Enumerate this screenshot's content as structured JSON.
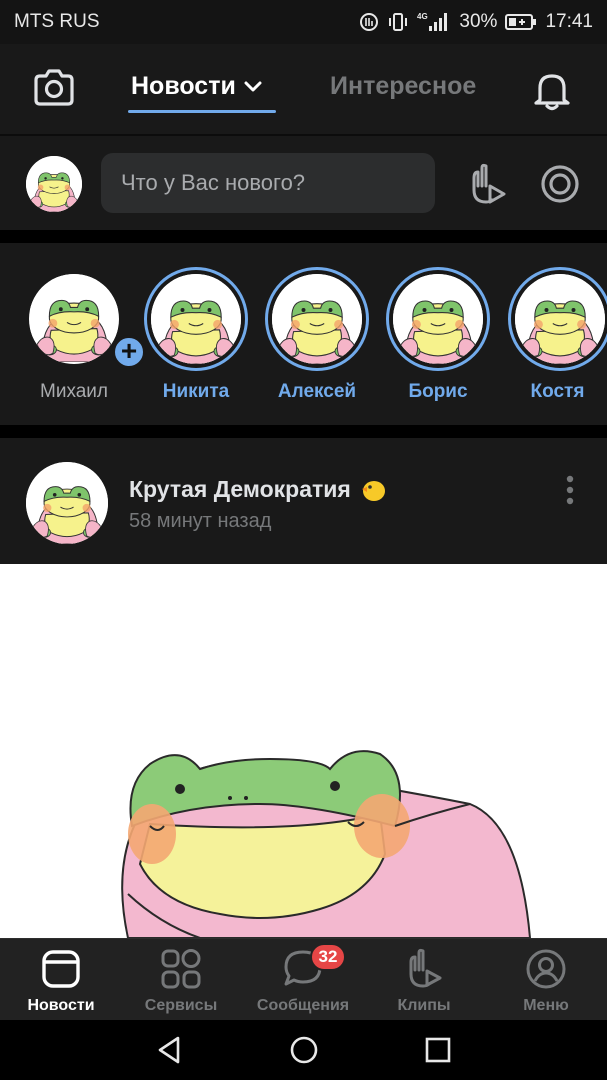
{
  "status_bar": {
    "carrier": "MTS RUS",
    "network": "4G",
    "battery": "30%",
    "time": "17:41"
  },
  "header": {
    "tab_news": "Новости",
    "tab_interesting": "Интересное",
    "camera_icon": "camera-icon",
    "bell_icon": "bell-icon"
  },
  "compose": {
    "placeholder": "Что у Вас нового?"
  },
  "stories": [
    {
      "name": "Михаил",
      "own": true
    },
    {
      "name": "Никита",
      "own": false
    },
    {
      "name": "Алексей",
      "own": false
    },
    {
      "name": "Борис",
      "own": false
    },
    {
      "name": "Костя",
      "own": false
    }
  ],
  "post": {
    "author": "Крутая Демократия",
    "time": "58 минут назад"
  },
  "tabbar": {
    "items": [
      {
        "label": "Новости",
        "icon": "news-icon",
        "active": true
      },
      {
        "label": "Сервисы",
        "icon": "services-icon",
        "active": false
      },
      {
        "label": "Сообщения",
        "icon": "messages-icon",
        "active": false,
        "badge": "32"
      },
      {
        "label": "Клипы",
        "icon": "clips-icon",
        "active": false
      },
      {
        "label": "Меню",
        "icon": "profile-icon",
        "active": false
      }
    ]
  },
  "colors": {
    "accent": "#71aaeb",
    "background": "#191919",
    "badge": "#e64646"
  }
}
